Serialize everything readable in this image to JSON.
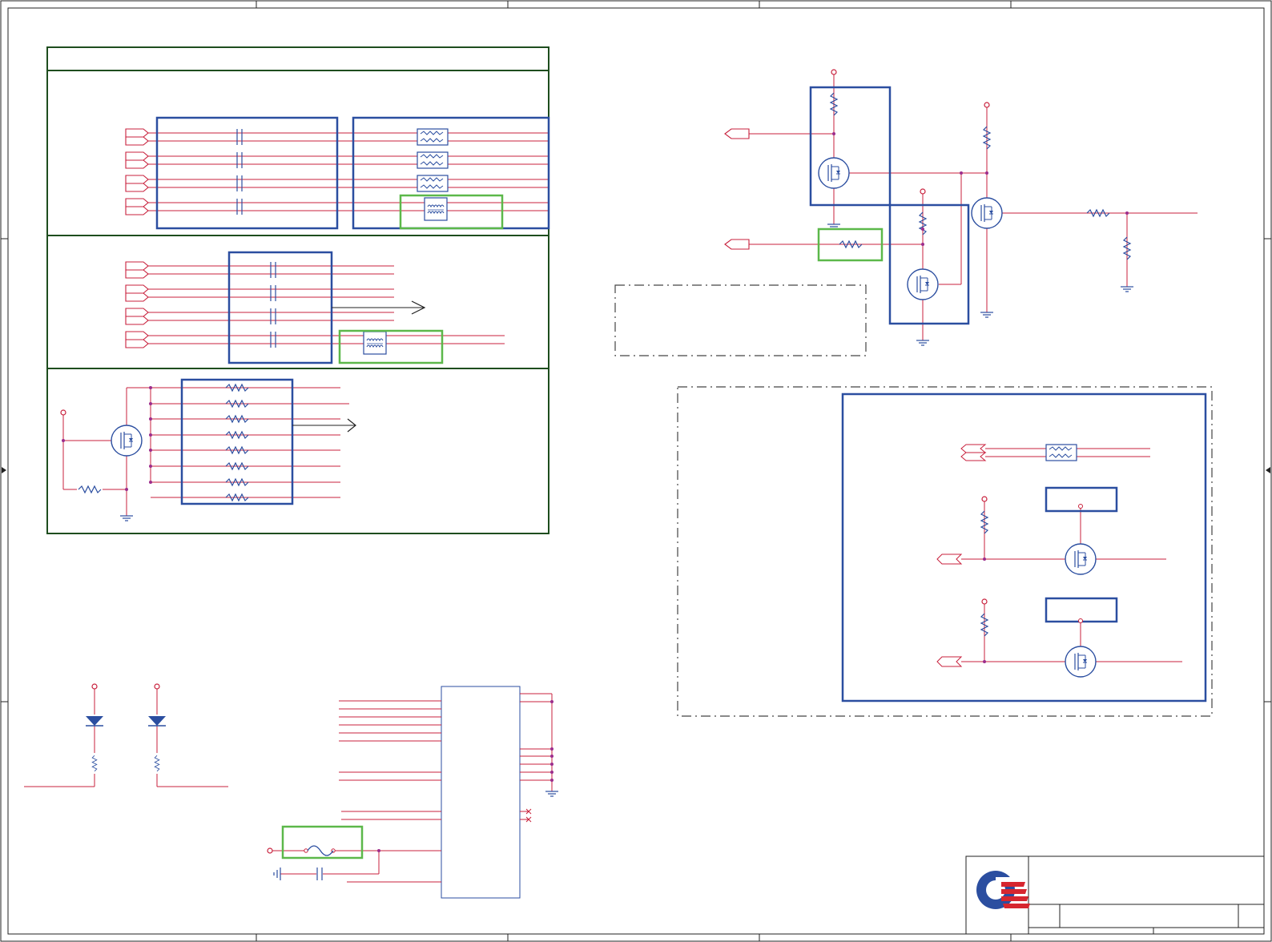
{
  "sheet": {
    "title_block": {
      "logo_icon": "quanta-logo-icon",
      "title": "",
      "size_label": "",
      "doc_number": "",
      "rev": ""
    }
  },
  "colors": {
    "wire": "#c8203c",
    "symbol": "#2b4ea0",
    "highlight": "#5cb84a",
    "frame": "#1e4d1e",
    "border": "#222222",
    "logo_red": "#d6262f",
    "logo_blue": "#2b4ea0"
  },
  "components": {
    "icons": [
      "capacitor-icon",
      "resistor-icon",
      "ferrite-bead-icon",
      "common-mode-choke-icon",
      "mosfet-icon",
      "diode-icon",
      "led-icon",
      "fuse-icon",
      "ground-icon",
      "power-rail-icon",
      "off-page-connector-icon",
      "connector-ic-body-icon"
    ]
  }
}
